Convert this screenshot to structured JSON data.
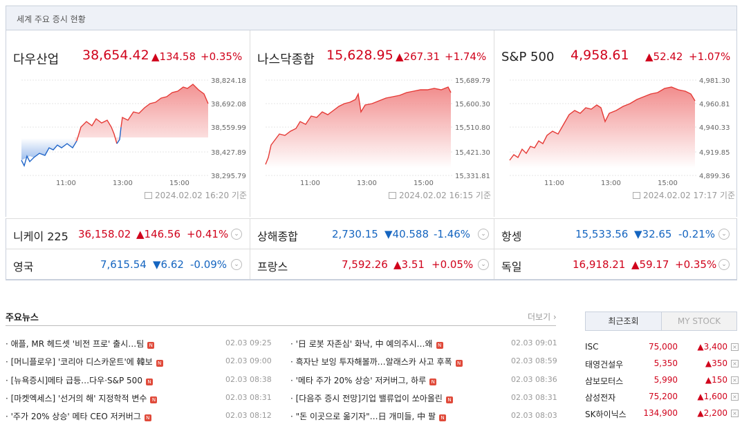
{
  "header": {
    "title": "세계 주요 증시 현황"
  },
  "indices": [
    {
      "name": "다우산업",
      "value": "38,654.42",
      "change": "▲134.58",
      "pct": "+0.35%",
      "yticks": [
        "38,824.18",
        "38,692.08",
        "38,559.99",
        "38,427.89",
        "38,295.79"
      ],
      "xticks": [
        "11:00",
        "13:00",
        "15:00"
      ],
      "stamp": "2024.02.02 16:20 기준"
    },
    {
      "name": "나스닥종합",
      "value": "15,628.95",
      "change": "▲267.31",
      "pct": "+1.74%",
      "yticks": [
        "15,689.79",
        "15,600.30",
        "15,510.80",
        "15,421.30",
        "15,331.81"
      ],
      "xticks": [
        "11:00",
        "13:00",
        "15:00"
      ],
      "stamp": "2024.02.02 16:15 기준"
    },
    {
      "name": "S&P 500",
      "value": "4,958.61",
      "change": "▲52.42",
      "pct": "+1.07%",
      "yticks": [
        "4,981.30",
        "4,960.81",
        "4,940.33",
        "4,919.85",
        "4,899.36"
      ],
      "xticks": [
        "11:00",
        "13:00",
        "15:00"
      ],
      "stamp": "2024.02.02 17:17 기준"
    }
  ],
  "rows": [
    {
      "name": "니케이 225",
      "value": "36,158.02",
      "change": "▲146.56",
      "pct": "+0.41%",
      "dir": "up"
    },
    {
      "name": "상해종합",
      "value": "2,730.15",
      "change": "▼40.588",
      "pct": "-1.46%",
      "dir": "dn"
    },
    {
      "name": "항셍",
      "value": "15,533.56",
      "change": "▼32.65",
      "pct": "-0.21%",
      "dir": "dn"
    },
    {
      "name": "영국",
      "value": "7,615.54",
      "change": "▼6.62",
      "pct": "-0.09%",
      "dir": "dn"
    },
    {
      "name": "프랑스",
      "value": "7,592.26",
      "change": "▲3.51",
      "pct": "+0.05%",
      "dir": "up"
    },
    {
      "name": "독일",
      "value": "16,918.21",
      "change": "▲59.17",
      "pct": "+0.35%",
      "dir": "up"
    }
  ],
  "news": {
    "title": "주요뉴스",
    "more": "더보기 ›",
    "left": [
      {
        "text": "· 애플, MR 헤드셋 '비전 프로' 출시…팀",
        "time": "02.03 09:25"
      },
      {
        "text": "· [머니플로우] '코리아 디스카운트'에 韓보",
        "time": "02.03 09:00"
      },
      {
        "text": "· [뉴욕증시]메타 급등…다우·S&P 500",
        "time": "02.03 08:38"
      },
      {
        "text": "· [마켓엑세스] '선거의 해' 지정학적 변수",
        "time": "02.03 08:31"
      },
      {
        "text": "· '주가 20% 상승' 메타 CEO 저커버그",
        "time": "02.03 08:12"
      }
    ],
    "right": [
      {
        "text": "· '日 로봇 자존심' 화낙, 中 예의주시…왜",
        "time": "02.03 09:01"
      },
      {
        "text": "· 흑자난 보잉 투자해볼까…알래스카 사고 후폭",
        "time": "02.03 08:59"
      },
      {
        "text": "· '메타 주가 20% 상승' 저커버그, 하루",
        "time": "02.03 08:36"
      },
      {
        "text": "· [다음주 증시 전망]기업 밸류업이 쏘아올린",
        "time": "02.03 08:31"
      },
      {
        "text": "· \"돈 이곳으로 옮기자\"…日 개미들, 中 팔",
        "time": "02.03 08:03"
      }
    ],
    "badge": "N"
  },
  "side": {
    "tab_recent": "최근조회",
    "tab_mystock": "MY STOCK",
    "stocks": [
      {
        "name": "ISC",
        "price": "75,000",
        "change": "▲3,400"
      },
      {
        "name": "태영건설우",
        "price": "5,350",
        "change": "▲350"
      },
      {
        "name": "삼보모터스",
        "price": "5,990",
        "change": "▲150"
      },
      {
        "name": "삼성전자",
        "price": "75,200",
        "change": "▲1,600"
      },
      {
        "name": "SK하이닉스",
        "price": "134,900",
        "change": "▲2,200"
      }
    ],
    "close": "×"
  },
  "colors": {
    "up": "#d0021b",
    "down": "#1565c0"
  }
}
